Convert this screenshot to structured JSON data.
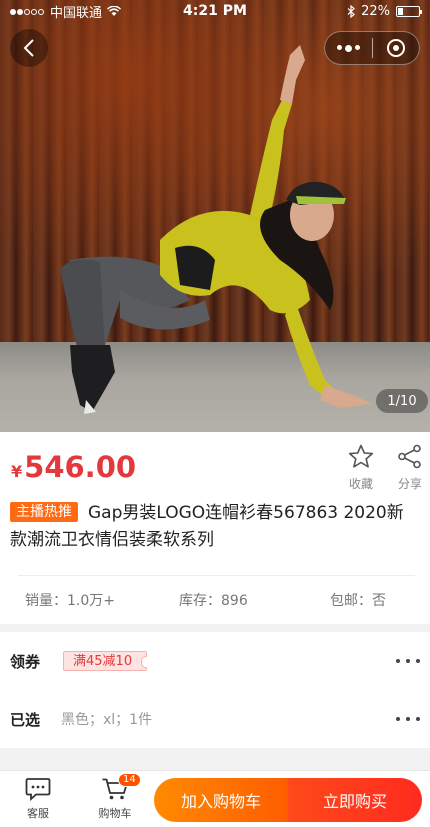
{
  "status_bar": {
    "carrier": "中国联通",
    "time": "4:21 PM",
    "battery": "22%"
  },
  "gallery": {
    "counter": "1/10"
  },
  "product": {
    "currency": "¥",
    "price": "546.00",
    "favorite_label": "收藏",
    "share_label": "分享",
    "tag": "主播热推",
    "title": "Gap男装LOGO连帽衫春567863 2020新款潮流卫衣情侣装柔软系列",
    "sales": "销量：1.0万+",
    "stock": "库存：896",
    "shipping": "包邮：否"
  },
  "options": {
    "coupon_label": "领券",
    "coupon_value": "满45减10",
    "selected_label": "已选",
    "selected_value": "黑色；xl；1件"
  },
  "bottom_bar": {
    "service_label": "客服",
    "cart_label": "购物车",
    "cart_count": "14",
    "add_to_cart": "加入购物车",
    "buy_now": "立即购买"
  },
  "colors": {
    "price_red": "#e4393c",
    "tag_orange": "#ff6a14",
    "cart_orange": "#ff7a00",
    "buy_red": "#ff3a1e"
  }
}
